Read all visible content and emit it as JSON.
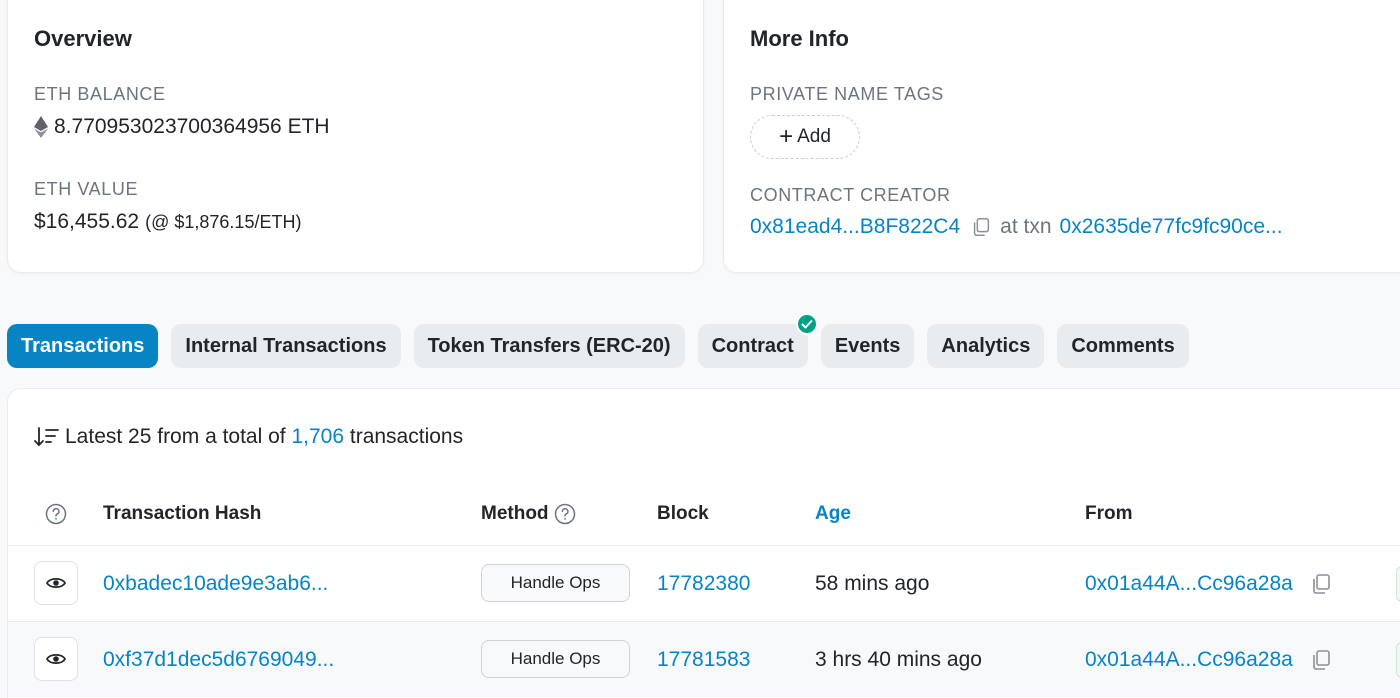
{
  "overview": {
    "title": "Overview",
    "eth_balance_label": "ETH BALANCE",
    "eth_balance_value": "8.770953023700364956 ETH",
    "eth_value_label": "ETH VALUE",
    "eth_value_usd": "$16,455.62",
    "eth_value_rate": "(@ $1,876.15/ETH)"
  },
  "more_info": {
    "title": "More Info",
    "private_tags_label": "PRIVATE NAME TAGS",
    "add_label": "Add",
    "contract_creator_label": "CONTRACT CREATOR",
    "creator_address": "0x81ead4...B8F822C4",
    "at_txn_label": "at txn",
    "creator_txn": "0x2635de77fc9fc90ce..."
  },
  "tabs": [
    {
      "label": "Transactions",
      "active": true
    },
    {
      "label": "Internal Transactions"
    },
    {
      "label": "Token Transfers (ERC-20)"
    },
    {
      "label": "Contract",
      "verified": true
    },
    {
      "label": "Events"
    },
    {
      "label": "Analytics"
    },
    {
      "label": "Comments"
    }
  ],
  "transactions": {
    "summary_prefix": "Latest 25 from a total of",
    "total": "1,706",
    "summary_suffix": "transactions",
    "columns": {
      "hash": "Transaction Hash",
      "method": "Method",
      "block": "Block",
      "age": "Age",
      "from": "From"
    },
    "rows": [
      {
        "hash": "0xbadec10ade9e3ab6...",
        "method": "Handle Ops",
        "block": "17782380",
        "age": "58 mins ago",
        "from": "0x01a44A...Cc96a28a"
      },
      {
        "hash": "0xf37d1dec5d6769049...",
        "method": "Handle Ops",
        "block": "17781583",
        "age": "3 hrs 40 mins ago",
        "from": "0x01a44A...Cc96a28a"
      }
    ]
  },
  "colors": {
    "accent": "#0784c3",
    "verified": "#00a186",
    "muted": "#6c757d"
  },
  "icons": {
    "eth": "ethereum-diamond-icon",
    "copy": "copy-icon",
    "help": "question-circle-icon",
    "sort": "sort-descending-icon",
    "eye": "eye-icon",
    "verified": "check-circle-icon"
  }
}
